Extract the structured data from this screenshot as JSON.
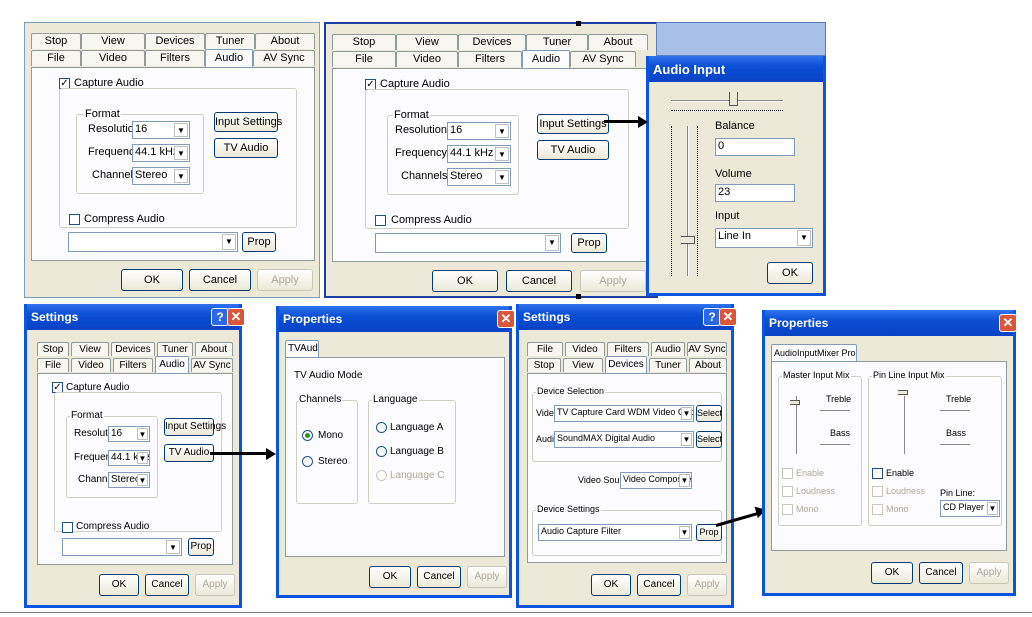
{
  "tabs_row1": [
    "Stop",
    "View",
    "Devices",
    "Tuner",
    "About"
  ],
  "tabs_row2": [
    "File",
    "Video",
    "Filters",
    "Audio",
    "AV Sync"
  ],
  "settings_tabs_row1": [
    "File",
    "Video",
    "Filters",
    "Audio",
    "AV Sync"
  ],
  "settings_tabs_row2": [
    "Stop",
    "View",
    "Devices",
    "Tuner",
    "About"
  ],
  "audio_tab": {
    "capture_label": "Capture Audio",
    "format_label": "Format",
    "resolution_label": "Resolution",
    "resolution_value": "16",
    "frequency_label": "Frequency",
    "frequency_value": "44.1 kHz",
    "channels_label": "Channels",
    "channels_value": "Stereo",
    "input_settings": "Input Settings",
    "tv_audio": "TV Audio",
    "compress_label": "Compress Audio",
    "prop": "Prop"
  },
  "buttons": {
    "ok": "OK",
    "cancel": "Cancel",
    "apply": "Apply"
  },
  "audio_input": {
    "title": "Audio Input",
    "balance_label": "Balance",
    "balance_value": "0",
    "volume_label": "Volume",
    "volume_value": "23",
    "input_label": "Input",
    "input_value": "Line In",
    "ok": "OK"
  },
  "settings_title": "Settings",
  "properties_title": "Properties",
  "tv_audio_dialog": {
    "tab": "TVAudio",
    "mode_label": "TV Audio Mode",
    "channels_label": "Channels",
    "mono": "Mono",
    "stereo": "Stereo",
    "language_label": "Language",
    "lang_a": "Language A",
    "lang_b": "Language B",
    "lang_c": "Language C"
  },
  "devices_tab": {
    "device_selection": "Device Selection",
    "video_label": "Video",
    "video_value": "TV Capture Card WDM Video Capture",
    "audio_label": "Audio",
    "audio_value": "SoundMAX Digital Audio",
    "select": "Select",
    "video_source_label": "Video Source",
    "video_source_value": "Video Composite",
    "device_settings": "Device Settings",
    "device_settings_value": "Audio Capture Filter",
    "prop": "Prop"
  },
  "mixer": {
    "tab": "AudioInputMixer Properties",
    "master_label": "Master Input Mix",
    "pinline_label": "Pin Line Input Mix",
    "treble": "Treble",
    "bass": "Bass",
    "enable": "Enable",
    "loudness": "Loudness",
    "mono": "Mono",
    "pin_line_label": "Pin Line:",
    "pin_line_value": "CD Player"
  }
}
